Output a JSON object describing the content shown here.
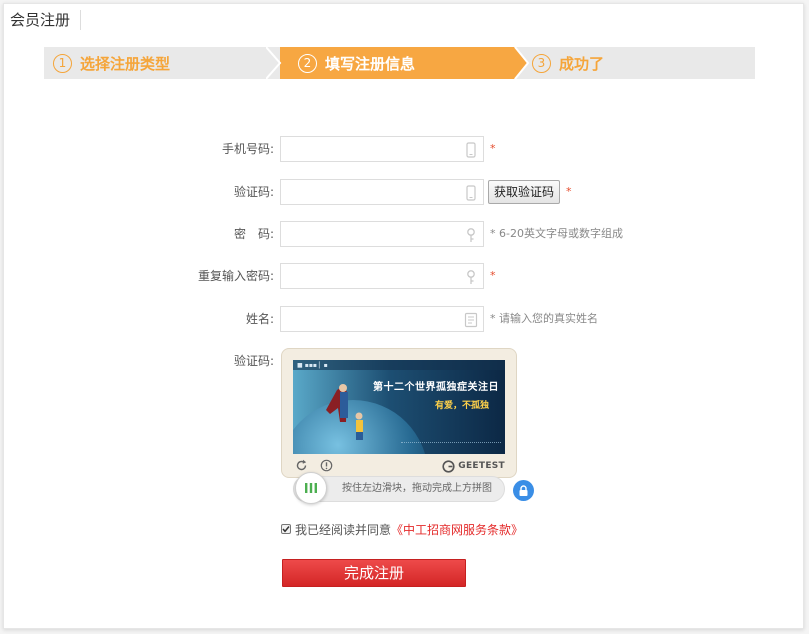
{
  "header": {
    "title": "会员注册"
  },
  "steps": [
    {
      "num": "1",
      "label": "选择注册类型",
      "state": "done"
    },
    {
      "num": "2",
      "label": "填写注册信息",
      "state": "active"
    },
    {
      "num": "3",
      "label": "成功了",
      "state": "pending"
    }
  ],
  "colors": {
    "accent": "#f7a742",
    "required": "#e54b2c",
    "submit": "#dd3333",
    "link": "#e42a2a"
  },
  "form": {
    "phone": {
      "label": "手机号码:",
      "value": "",
      "required_mark": "*"
    },
    "sms_code": {
      "label": "验证码:",
      "value": "",
      "required_mark": "*",
      "button_label": "获取验证码"
    },
    "password": {
      "label": "密　码:",
      "value": "",
      "hint": "* 6-20英文字母或数字组成"
    },
    "confirm_password": {
      "label": "重复输入密码:",
      "value": "",
      "required_mark": "*"
    },
    "name": {
      "label": "姓名:",
      "value": "",
      "hint": "* 请输入您的真实姓名"
    },
    "captcha": {
      "label": "验证码:",
      "image_headline": "第十二个世界孤独症关注日",
      "image_subline": "有爱，不孤独",
      "brand": "GEETEST",
      "slider_text": "按住左边滑块，拖动完成上方拼图",
      "slider_progress": 0
    },
    "agree": {
      "checked": true,
      "text": "我已经阅读并同意",
      "terms_link": "《中工招商网服务条款》"
    },
    "submit_label": "完成注册"
  }
}
